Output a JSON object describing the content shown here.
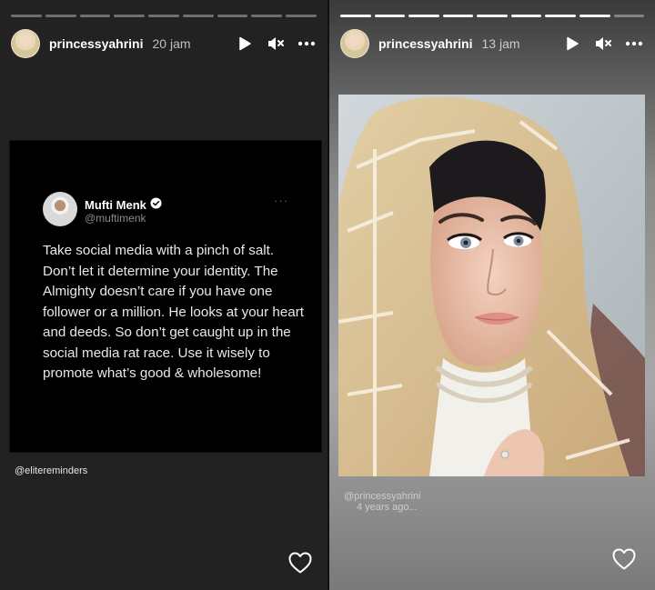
{
  "left_story": {
    "progress": {
      "segments": 9,
      "completed": 0
    },
    "header": {
      "username": "princessyahrini",
      "time": "20 jam",
      "icons": [
        "play-icon",
        "mute-icon",
        "more-icon"
      ]
    },
    "tweet": {
      "author_name": "Mufti Menk",
      "verified": true,
      "author_handle": "@muftimenk",
      "more": "···",
      "text": "Take social media with a pinch of salt. Don’t let it determine your identity. The Almighty doesn’t care if you have one follower or a million. He looks at your heart and deeds. So don’t get caught up in the social media rat race. Use it wisely to promote what’s good & wholesome!"
    },
    "credit": "@elitereminders",
    "like_icon": "heart-icon"
  },
  "right_story": {
    "progress": {
      "segments": 9,
      "completed": 8
    },
    "header": {
      "username": "princessyahrini",
      "time": "13 jam",
      "icons": [
        "play-icon",
        "mute-icon",
        "more-icon"
      ]
    },
    "photo": "portrait-photo",
    "watermark": {
      "handle": "@princessyahrini",
      "ago": "4 years ago..."
    },
    "like_icon": "heart-icon"
  },
  "colors": {
    "left_bg": "#222222",
    "tweet_bg": "#000000",
    "verified": "#ffffff",
    "text": "#ffffff"
  }
}
